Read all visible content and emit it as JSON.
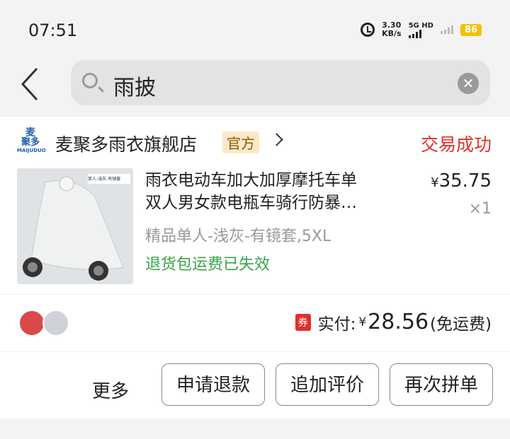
{
  "status_bar": {
    "time": "07:51",
    "speed_value": "3.30",
    "speed_unit": "KB/s",
    "network": "5G HD",
    "battery": "86"
  },
  "search": {
    "query": "雨披"
  },
  "order": {
    "shop_name": "麦聚多雨衣旗舰店",
    "shop_badge": "官方",
    "shop_logo_line1": "麦",
    "shop_logo_line2": "聚多",
    "shop_logo_sub": "MAIJUDUO",
    "status": "交易成功",
    "item_title_line1": "雨衣电动车加大加厚摩托车单",
    "item_title_line2": "双人男女款电瓶车骑行防暴…",
    "spec": "精品单人-浅灰-有镜套,5XL",
    "refund_note": "退货包运费已失效",
    "price_symbol": "¥",
    "price": "35.75",
    "quantity": "×1",
    "thumb_label": "单人-浅灰-有镜套"
  },
  "payment": {
    "coupon_label": "券",
    "paid_label": "实付:",
    "currency": "¥",
    "amount": "28.56",
    "shipping_note": "(免运费)"
  },
  "actions": {
    "more": "更多",
    "refund": "申请退款",
    "review": "追加评价",
    "rebuy": "再次拼单"
  },
  "colors": {
    "accent_red": "#e0302a",
    "green": "#3aa34a",
    "badge_bg": "#fde8c8"
  }
}
